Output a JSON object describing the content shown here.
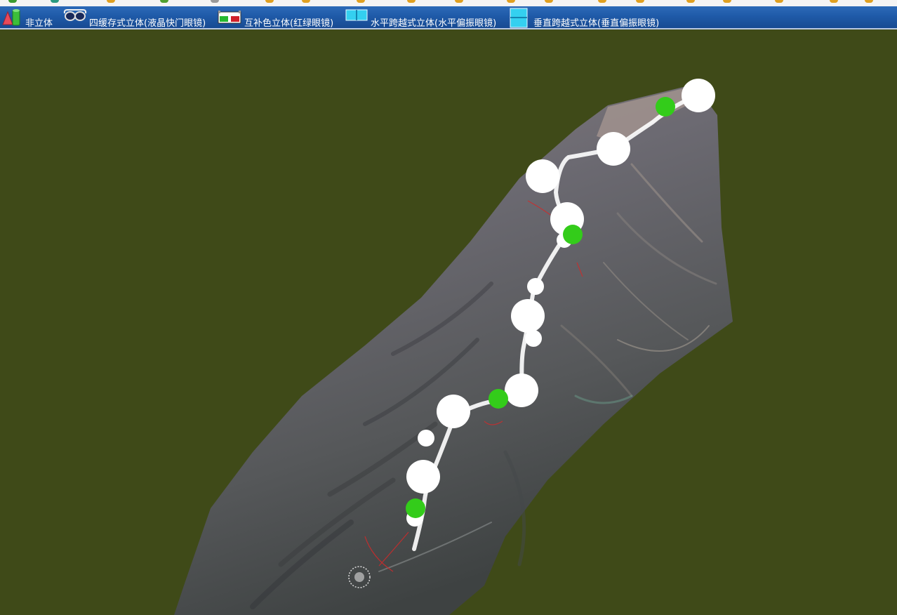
{
  "toolbar": {
    "items": [
      {
        "label": "非立体",
        "icon": "mono-view-icon"
      },
      {
        "label": "四缓存式立体(液晶快门眼镜)",
        "icon": "shutter-glasses-icon"
      },
      {
        "label": "互补色立体(红绿眼镜)",
        "icon": "red-green-glasses-icon"
      },
      {
        "label": "水平跨越式立体(水平偏振眼镜)",
        "icon": "horizontal-split-icon"
      },
      {
        "label": "垂直跨越式立体(垂直偏振眼镜)",
        "icon": "vertical-split-icon"
      }
    ]
  },
  "scene": {
    "background_color": "#3f4a18",
    "terrain_color": "#6a6570",
    "route_color": "#ffffff",
    "marker_white_color": "#ffffff",
    "marker_green_color": "#33cc1a"
  }
}
